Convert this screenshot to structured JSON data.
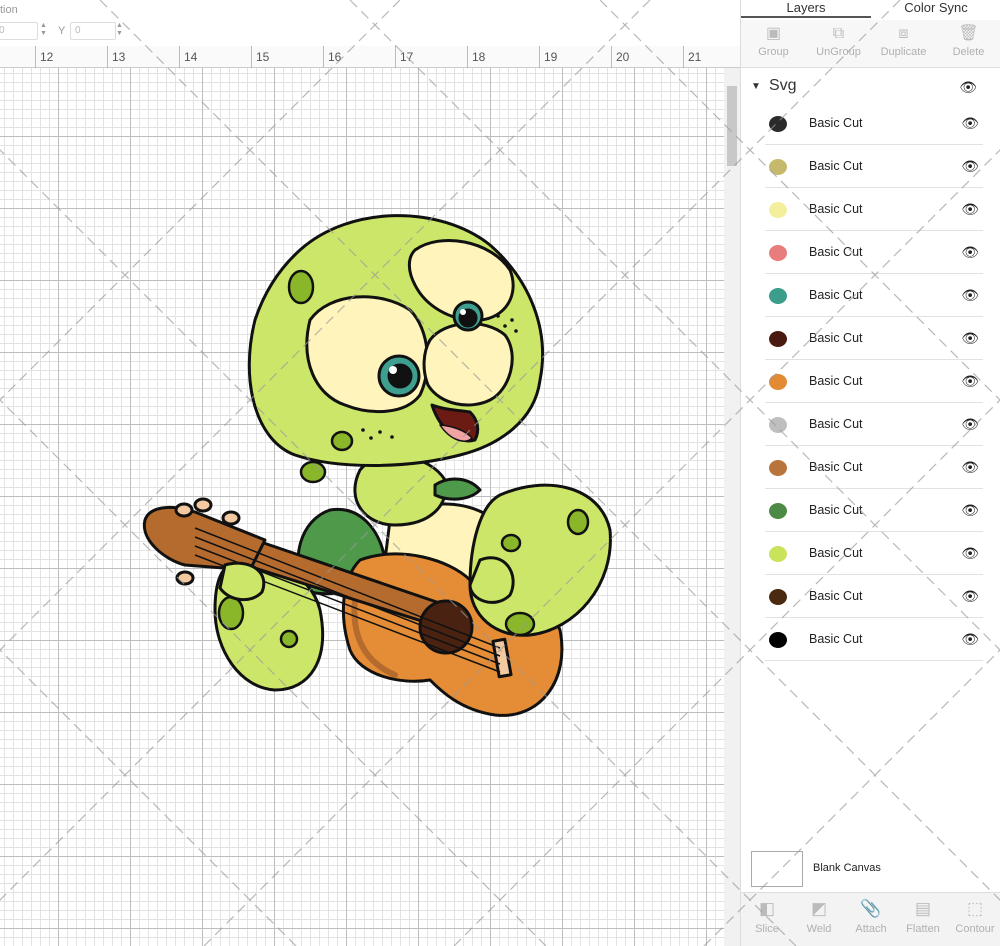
{
  "position_bar": {
    "x_label": "tion",
    "x_value": "0",
    "y_label": "Y",
    "y_value": "0"
  },
  "ruler": {
    "numbers": [
      "12",
      "13",
      "14",
      "15",
      "16",
      "17",
      "18",
      "19",
      "20",
      "21"
    ]
  },
  "panel": {
    "tabs": [
      {
        "label": "Layers",
        "active": true
      },
      {
        "label": "Color Sync",
        "active": false
      }
    ],
    "toolbar": [
      {
        "label": "Group",
        "icon": "group-icon"
      },
      {
        "label": "UnGroup",
        "icon": "ungroup-icon"
      },
      {
        "label": "Duplicate",
        "icon": "duplicate-icon"
      },
      {
        "label": "Delete",
        "icon": "delete-icon"
      }
    ],
    "group_name": "Svg",
    "layers": [
      {
        "name": "Basic Cut",
        "color": "#2b2b2b"
      },
      {
        "name": "Basic Cut",
        "color": "#c6b96b"
      },
      {
        "name": "Basic Cut",
        "color": "#f3ef9c"
      },
      {
        "name": "Basic Cut",
        "color": "#e97c7c"
      },
      {
        "name": "Basic Cut",
        "color": "#3b9e8a"
      },
      {
        "name": "Basic Cut",
        "color": "#4a1a10"
      },
      {
        "name": "Basic Cut",
        "color": "#e28a34"
      },
      {
        "name": "Basic Cut",
        "color": "#bfbfbf"
      },
      {
        "name": "Basic Cut",
        "color": "#b8743a"
      },
      {
        "name": "Basic Cut",
        "color": "#4d8a45"
      },
      {
        "name": "Basic Cut",
        "color": "#c9e35a"
      },
      {
        "name": "Basic Cut",
        "color": "#4a2a10"
      },
      {
        "name": "Basic Cut",
        "color": "#000000"
      }
    ],
    "blank_canvas_label": "Blank Canvas",
    "bottom_tools": [
      {
        "label": "Slice",
        "icon": "slice-icon"
      },
      {
        "label": "Weld",
        "icon": "weld-icon"
      },
      {
        "label": "Attach",
        "icon": "attach-icon"
      },
      {
        "label": "Flatten",
        "icon": "flatten-icon"
      },
      {
        "label": "Contour",
        "icon": "contour-icon"
      }
    ]
  },
  "colors": {
    "turtle_green": "#cce66a",
    "turtle_spots": "#8ab62a",
    "shell_dark": "#4e9a4a",
    "face_cream": "#fff4bb",
    "eye_teal": "#3e9f8e",
    "guitar_orange": "#e48c36",
    "guitar_brown": "#b56b2e",
    "soundhole": "#4a2212",
    "tongue": "#f2a3a3"
  }
}
